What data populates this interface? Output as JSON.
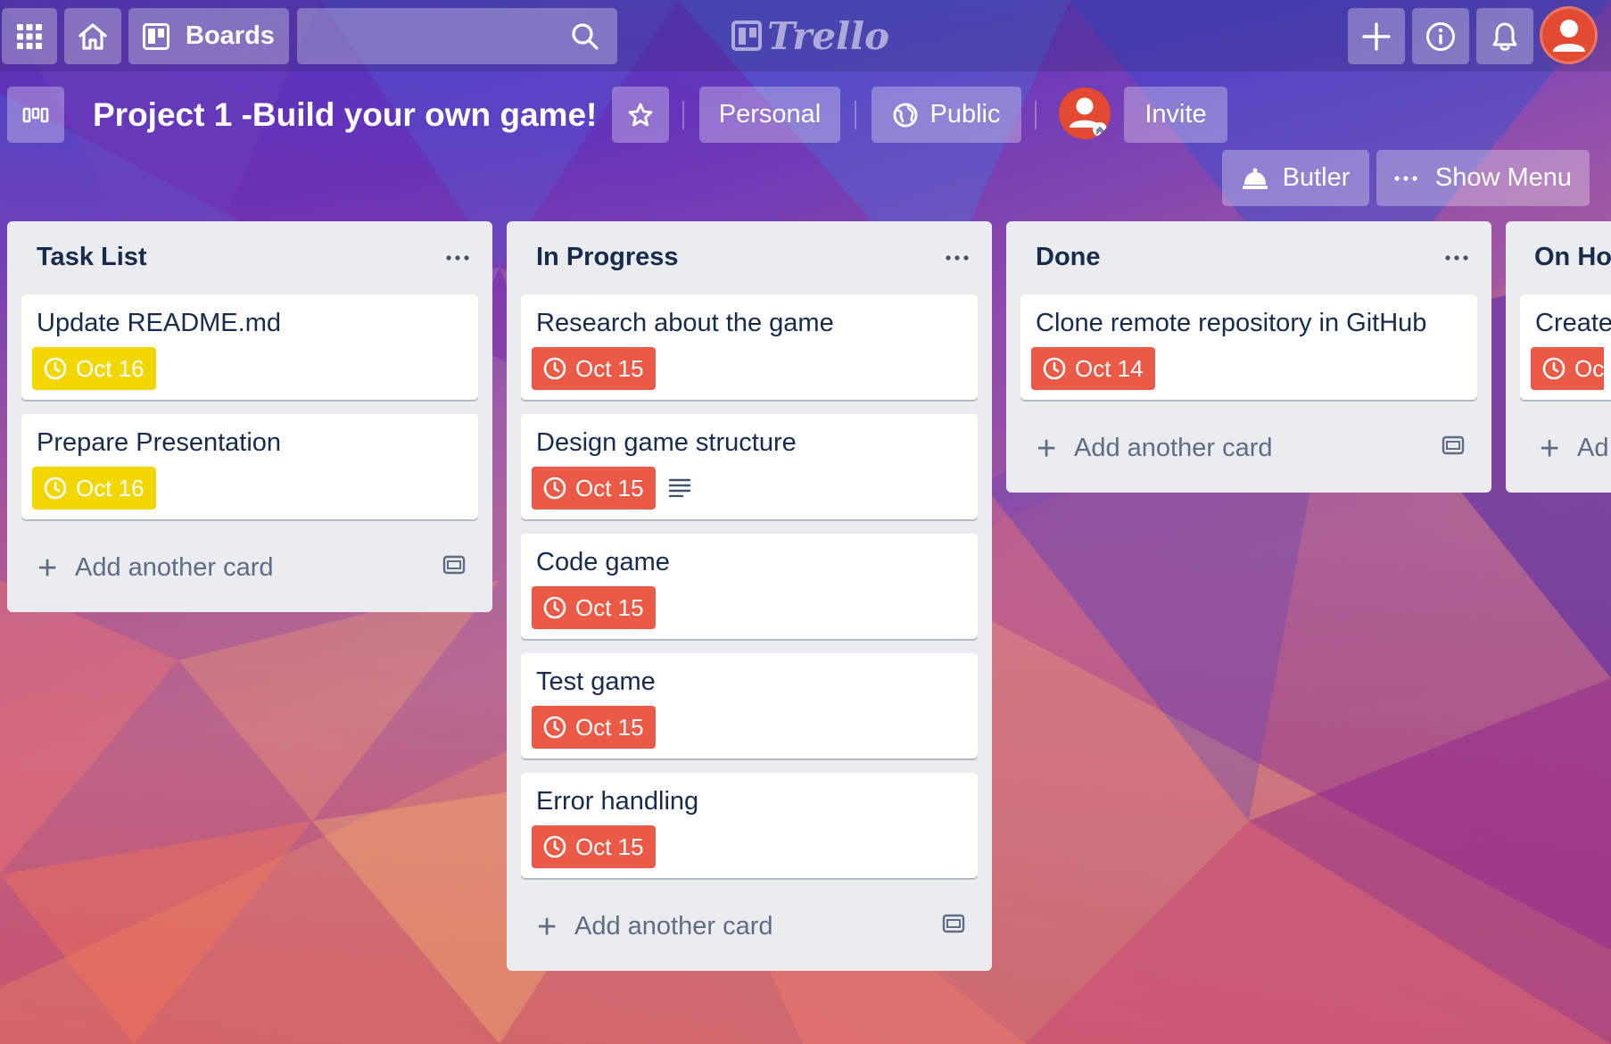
{
  "topbar": {
    "apps_icon": "grid-icon",
    "home_icon": "home-icon",
    "boards_label": "Boards",
    "search_icon": "search-icon",
    "logo_text": "Trello",
    "add_icon": "plus-icon",
    "info_icon": "info-icon",
    "notifications_icon": "bell-icon",
    "account_icon": "user-avatar"
  },
  "board": {
    "title": "Project 1 -Build your own game!",
    "star_icon": "star-icon",
    "visibility_team": "Personal",
    "visibility": "Public",
    "globe_icon": "globe-icon",
    "invite_label": "Invite",
    "butler_label": "Butler",
    "show_menu_label": "Show Menu"
  },
  "colors": {
    "due_soon": "#f2d600",
    "overdue": "#eb5a46",
    "list_bg": "#ebecf0",
    "avatar": "#e24a32"
  },
  "lists": [
    {
      "title": "Task List",
      "cards": [
        {
          "title": "Update README.md",
          "due": "Oct 16",
          "status": "due_soon"
        },
        {
          "title": "Prepare Presentation",
          "due": "Oct 16",
          "status": "due_soon"
        }
      ],
      "add_label": "Add another card"
    },
    {
      "title": "In Progress",
      "cards": [
        {
          "title": "Research about the game",
          "due": "Oct 15",
          "status": "overdue"
        },
        {
          "title": "Design game structure",
          "due": "Oct 15",
          "status": "overdue",
          "has_description": true
        },
        {
          "title": "Code game",
          "due": "Oct 15",
          "status": "overdue"
        },
        {
          "title": "Test game",
          "due": "Oct 15",
          "status": "overdue"
        },
        {
          "title": "Error handling",
          "due": "Oct 15",
          "status": "overdue"
        }
      ],
      "add_label": "Add another card"
    },
    {
      "title": "Done",
      "cards": [
        {
          "title": "Clone remote repository in GitHub",
          "due": "Oct 14",
          "status": "overdue"
        }
      ],
      "add_label": "Add another card"
    },
    {
      "title": "On Ho",
      "cards": [
        {
          "title": "Create",
          "due": "Oc",
          "status": "overdue"
        }
      ],
      "add_label": "Ad"
    }
  ]
}
